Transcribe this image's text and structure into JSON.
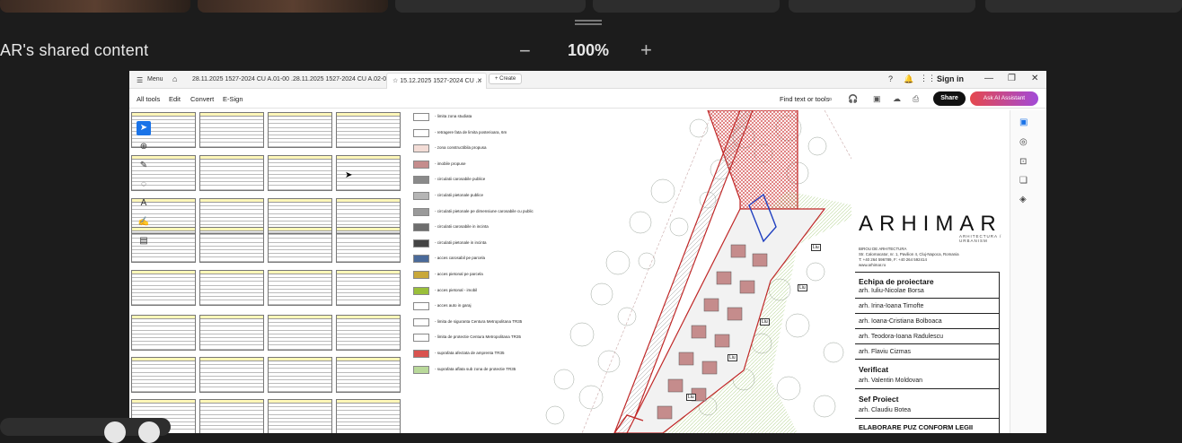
{
  "meeting": {
    "shared_title": "AR's shared content",
    "zoom_minus": "−",
    "zoom_level": "100%",
    "zoom_plus": "+"
  },
  "browser": {
    "menu_label": "Menu",
    "tabs": [
      {
        "label": "28.11.2025 1527-2024 CU A.01-00 ..."
      },
      {
        "label": "28.11.2025 1527-2024 CU A.02-00..."
      },
      {
        "label": "15.12.2025 1527-2024 CU ..."
      }
    ],
    "create_label": "+ Create",
    "signin_label": "Sign in",
    "menu_items": [
      "All tools",
      "Edit",
      "Convert",
      "E-Sign"
    ],
    "find_label": "Find text or tools",
    "share_label": "Share",
    "ai_label": "Ask AI Assistant"
  },
  "legend": [
    {
      "text": "- limita zona studiata",
      "color": "#ffffff"
    },
    {
      "text": "- retragere fata de limita posterioara, 6m",
      "color": "#ffffff"
    },
    {
      "text": "- zona constructibila propusa",
      "color": "#f3dcd6"
    },
    {
      "text": "- imobile propuse",
      "color": "#c58c8c"
    },
    {
      "text": "- circulatii carosabile publice",
      "color": "#8a8a8a"
    },
    {
      "text": "- circulatii pietonale publice",
      "color": "#b5b5b5"
    },
    {
      "text": "- circulatii pietonale pe dimensiune carosabile cu public",
      "color": "#9a9a9a"
    },
    {
      "text": "- circulatii carosabile in incinta",
      "color": "#6e6e6e"
    },
    {
      "text": "- circulatii pietonale in incinta",
      "color": "#444444"
    },
    {
      "text": "- acces carosabil pe parcela",
      "color": "#4a6a9a"
    },
    {
      "text": "- acces pietonal pe parcela",
      "color": "#c9a83a"
    },
    {
      "text": "- acces pietonal - imobil",
      "color": "#9abf3a"
    },
    {
      "text": "- acces auto in garaj",
      "color": "#ffffff"
    },
    {
      "text": "- limita de siguranta Centura Metropolitana TR35",
      "color": "#ffffff"
    },
    {
      "text": "- limita de protectie Centura Metropolitana TR35",
      "color": "#ffffff"
    },
    {
      "text": "- suprafata afectata de amprenta TR35",
      "color": "#d9534f"
    },
    {
      "text": "- suprafata aflata sub zona de protectie TR35",
      "color": "#b9d99a"
    }
  ],
  "titleblock": {
    "logo": "ARHIMAR",
    "subtitle": "ARHITECTURA / URBANISM",
    "firm_line1": "BIROU DE ARHITECTURA",
    "firm_line2": "Str. Calomacator, nr. 1, Pavilion 4, Cluj-Napoca, Romania",
    "firm_line3": "T: +40 264 596789, F: +40 264 592414",
    "firm_line4": "www.arhimar.ro",
    "team_heading": "Echipa de proiectare",
    "team": [
      "arh. Iuliu-Nicolae Borsa",
      "arh. Irina-Ioana Timofte",
      "arh. Ioana-Cristiana Bolboaca",
      "arh. Teodora-Ioana Radulescu",
      "arh. Flaviu Cizmas"
    ],
    "verif_heading": "Verificat",
    "verif_name": "arh. Valentin Moldovan",
    "chief_heading": "Sef Proiect",
    "chief_name": "arh. Claudiu Botea",
    "project": "ELABORARE PUZ CONFORM LEGII"
  },
  "plan_labels": [
    "Liu",
    "Liu",
    "Liu",
    "Liu",
    "Liu"
  ]
}
